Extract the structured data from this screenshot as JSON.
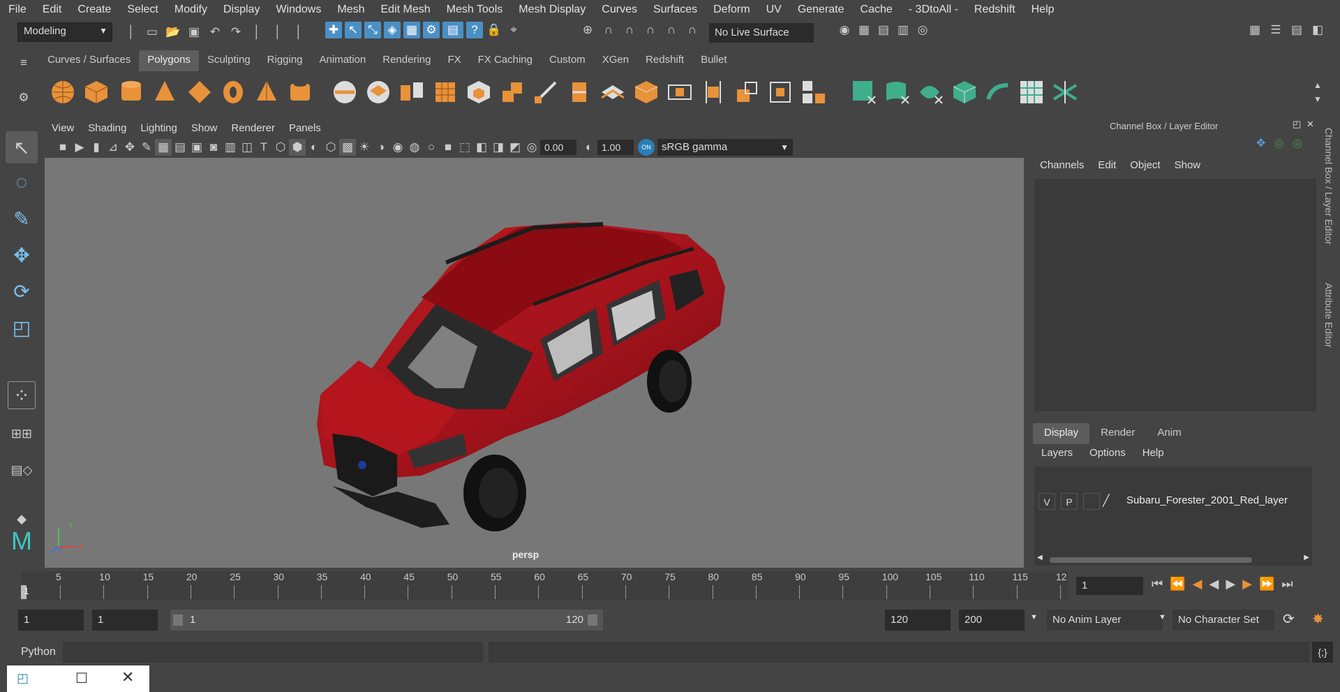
{
  "menubar": [
    "File",
    "Edit",
    "Create",
    "Select",
    "Modify",
    "Display",
    "Windows",
    "Mesh",
    "Edit Mesh",
    "Mesh Tools",
    "Mesh Display",
    "Curves",
    "Surfaces",
    "Deform",
    "UV",
    "Generate",
    "Cache",
    "- 3DtoAll -",
    "Redshift",
    "Help"
  ],
  "status": {
    "mode": "Modeling",
    "live_surface": "No Live Surface"
  },
  "shelf_tabs": [
    "Curves / Surfaces",
    "Polygons",
    "Sculpting",
    "Rigging",
    "Animation",
    "Rendering",
    "FX",
    "FX Caching",
    "Custom",
    "XGen",
    "Redshift",
    "Bullet"
  ],
  "shelf_active": "Polygons",
  "viewport": {
    "menu": [
      "View",
      "Shading",
      "Lighting",
      "Show",
      "Renderer",
      "Panels"
    ],
    "exposure": "0.00",
    "gamma": "1.00",
    "color_space": "sRGB gamma",
    "camera_label": "persp",
    "axis_y": "y",
    "axis_x": "x",
    "axis_z": "z"
  },
  "channel_box": {
    "title": "Channel Box / Layer Editor",
    "menu": [
      "Channels",
      "Edit",
      "Object",
      "Show"
    ]
  },
  "layer_editor": {
    "tabs": [
      "Display",
      "Render",
      "Anim"
    ],
    "menu": [
      "Layers",
      "Options",
      "Help"
    ],
    "layer": {
      "visible": "V",
      "playback": "P",
      "name": "Subaru_Forester_2001_Red_layer"
    }
  },
  "side_tabs": [
    "Channel Box / Layer Editor",
    "Attribute Editor"
  ],
  "timeline": {
    "current_frame_marker": "1",
    "ticks": [
      "5",
      "10",
      "15",
      "20",
      "25",
      "30",
      "35",
      "40",
      "45",
      "50",
      "55",
      "60",
      "65",
      "70",
      "75",
      "80",
      "85",
      "90",
      "95",
      "100",
      "105",
      "110",
      "115",
      "12"
    ],
    "current_frame": "1"
  },
  "range": {
    "start": "1",
    "playback_start": "1",
    "slider_start": "1",
    "slider_end": "120",
    "playback_end": "120",
    "end": "200",
    "anim_layer": "No Anim Layer",
    "character_set": "No Character Set"
  },
  "cmdline": {
    "language": "Python"
  },
  "colors": {
    "accent": "#4a90c4",
    "shelf_orange": "#e8923a",
    "shelf_teal": "#3fae8c",
    "car_red": "#a0121a"
  }
}
